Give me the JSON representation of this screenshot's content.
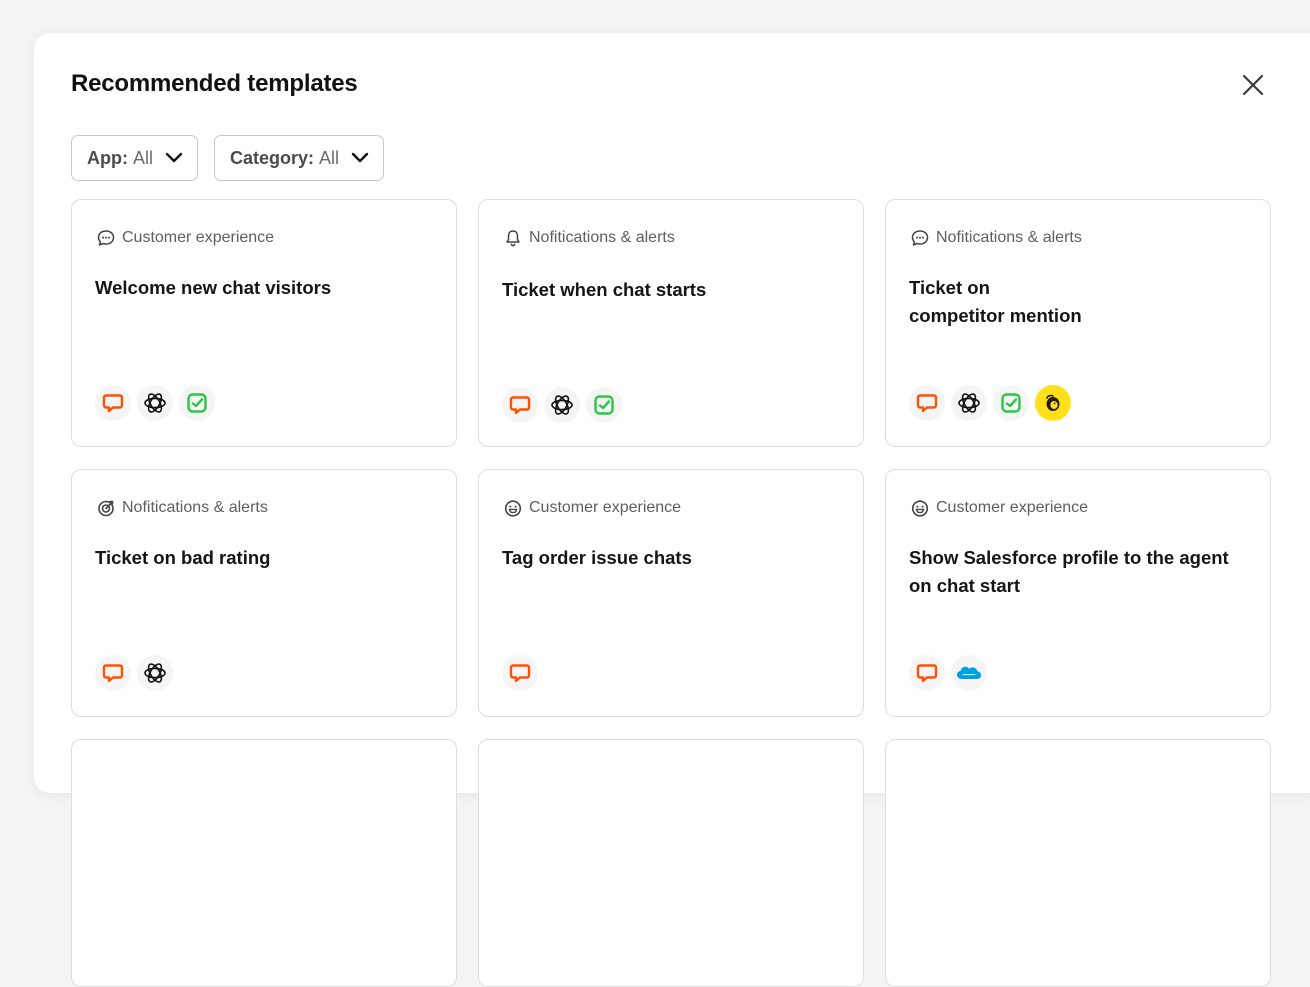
{
  "modal": {
    "title": "Recommended templates",
    "close_icon": "close-icon"
  },
  "filters": [
    {
      "label": "App:",
      "value": "All",
      "icon": "chevron-down-icon"
    },
    {
      "label": "Category:",
      "value": "All",
      "icon": "chevron-down-icon"
    }
  ],
  "cards": [
    {
      "category": "Customer experience",
      "category_icon": "chat-bubble-icon",
      "title": "Welcome new chat visitors",
      "apps": [
        "livechat-app-icon",
        "openai-app-icon",
        "tasks-app-icon"
      ]
    },
    {
      "category": "Nofitications & alerts",
      "category_icon": "bell-icon",
      "title": "Ticket when chat starts",
      "apps": [
        "livechat-app-icon",
        "openai-app-icon",
        "tasks-app-icon"
      ]
    },
    {
      "category": "Nofitications & alerts",
      "category_icon": "chat-bubble-icon",
      "title": "Ticket on\ncompetitor mention",
      "apps": [
        "livechat-app-icon",
        "openai-app-icon",
        "tasks-app-icon",
        "mailchimp-app-icon"
      ]
    },
    {
      "category": "Nofitications & alerts",
      "category_icon": "target-icon",
      "title": "Ticket on bad rating",
      "apps": [
        "livechat-app-icon",
        "openai-app-icon"
      ]
    },
    {
      "category": "Customer experience",
      "category_icon": "smiley-icon",
      "title": "Tag order issue chats",
      "apps": [
        "livechat-app-icon"
      ]
    },
    {
      "category": "Customer experience",
      "category_icon": "smiley-icon",
      "title": "Show Salesforce profile to the agent on chat start",
      "apps": [
        "livechat-app-icon",
        "salesforce-app-icon"
      ]
    }
  ],
  "colors": {
    "livechat": "#ff5100",
    "tasks": "#2bc646",
    "mailchimp": "#ffe01b",
    "salesforce": "#00a1e0"
  }
}
